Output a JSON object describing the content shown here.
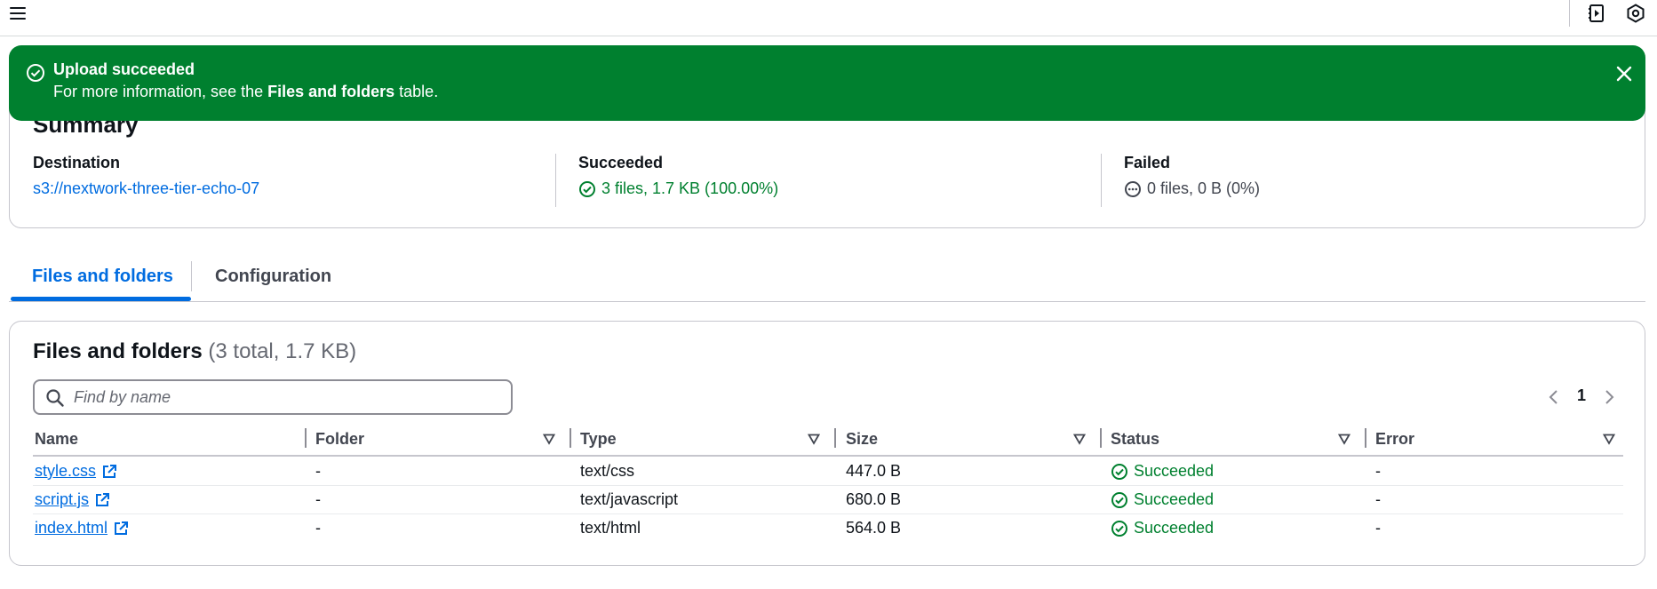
{
  "flash": {
    "title": "Upload succeeded",
    "message_prefix": "For more information, see the ",
    "message_bold": "Files and folders",
    "message_suffix": " table."
  },
  "summary": {
    "title": "Summary",
    "destination_label": "Destination",
    "destination_value": "s3://nextwork-three-tier-echo-07",
    "succeeded_label": "Succeeded",
    "succeeded_value": "3 files, 1.7 KB (100.00%)",
    "failed_label": "Failed",
    "failed_value": "0 files, 0 B (0%)"
  },
  "tabs": [
    {
      "label": "Files and folders",
      "active": true
    },
    {
      "label": "Configuration",
      "active": false
    }
  ],
  "files_table": {
    "title": "Files and folders",
    "count": "(3 total, 1.7 KB)",
    "search_placeholder": "Find by name",
    "page": "1",
    "columns": [
      "Name",
      "Folder",
      "Type",
      "Size",
      "Status",
      "Error"
    ],
    "rows": [
      {
        "name": "style.css",
        "folder": "-",
        "type": "text/css",
        "size": "447.0 B",
        "status": "Succeeded",
        "error": "-"
      },
      {
        "name": "script.js",
        "folder": "-",
        "type": "text/javascript",
        "size": "680.0 B",
        "status": "Succeeded",
        "error": "-"
      },
      {
        "name": "index.html",
        "folder": "-",
        "type": "text/html",
        "size": "564.0 B",
        "status": "Succeeded",
        "error": "-"
      }
    ]
  },
  "colors": {
    "success": "#00802f",
    "link": "#006ce0",
    "text": "#0f141a",
    "border": "#c6c6cd"
  }
}
